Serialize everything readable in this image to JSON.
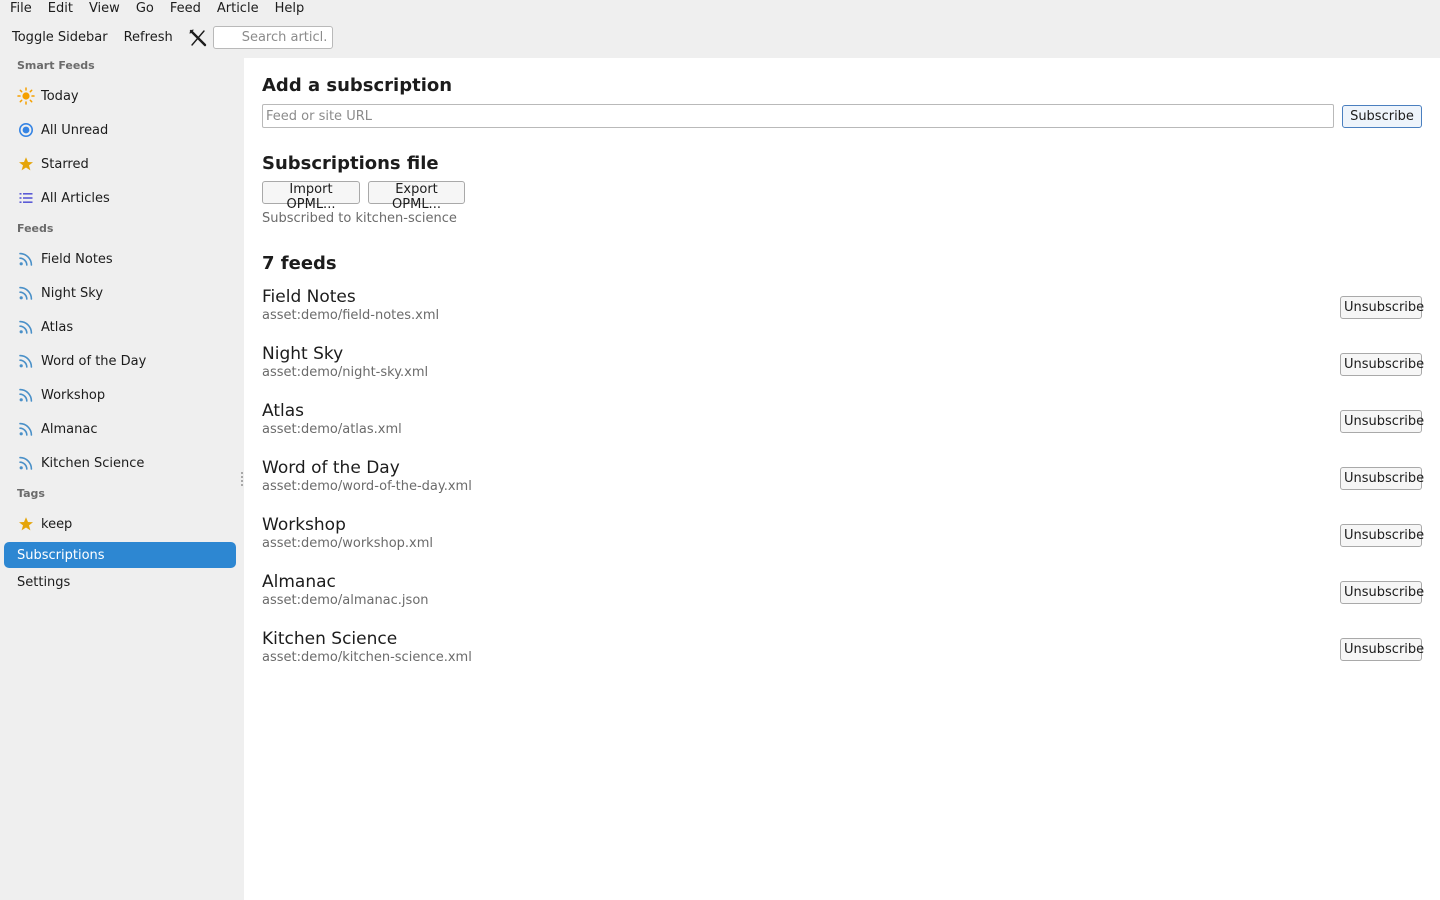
{
  "menu": [
    "File",
    "Edit",
    "View",
    "Go",
    "Feed",
    "Article",
    "Help"
  ],
  "toolbar": {
    "toggle_sidebar": "Toggle Sidebar",
    "refresh": "Refresh",
    "clear_icon": "close-x-icon",
    "search_placeholder": "Search articl..."
  },
  "sidebar": {
    "smart_feeds_label": "Smart Feeds",
    "smart_feeds": [
      {
        "label": "Today",
        "icon": "sun-icon"
      },
      {
        "label": "All Unread",
        "icon": "radio-circle-icon"
      },
      {
        "label": "Starred",
        "icon": "star-icon"
      },
      {
        "label": "All Articles",
        "icon": "list-icon"
      }
    ],
    "feeds_label": "Feeds",
    "feeds": [
      {
        "label": "Field Notes",
        "icon": "rss-icon"
      },
      {
        "label": "Night Sky",
        "icon": "rss-icon"
      },
      {
        "label": "Atlas",
        "icon": "rss-icon"
      },
      {
        "label": "Word of the Day",
        "icon": "rss-icon"
      },
      {
        "label": "Workshop",
        "icon": "rss-icon"
      },
      {
        "label": "Almanac",
        "icon": "rss-icon"
      },
      {
        "label": "Kitchen Science",
        "icon": "rss-icon"
      }
    ],
    "tags_label": "Tags",
    "tags": [
      {
        "label": "keep",
        "icon": "star-icon"
      }
    ],
    "subscriptions": "Subscriptions",
    "settings": "Settings"
  },
  "main": {
    "add_heading": "Add a subscription",
    "url_placeholder": "Feed or site URL",
    "subscribe_button": "Subscribe",
    "file_heading": "Subscriptions file",
    "import_button": "Import OPML...",
    "export_button": "Export OPML...",
    "status": "Subscribed to kitchen-science",
    "feeds_heading": "7 feeds",
    "unsubscribe_label": "Unsubscribe",
    "feed_list": [
      {
        "name": "Field Notes",
        "url": "asset:demo/field-notes.xml"
      },
      {
        "name": "Night Sky",
        "url": "asset:demo/night-sky.xml"
      },
      {
        "name": "Atlas",
        "url": "asset:demo/atlas.xml"
      },
      {
        "name": "Word of the Day",
        "url": "asset:demo/word-of-the-day.xml"
      },
      {
        "name": "Workshop",
        "url": "asset:demo/workshop.xml"
      },
      {
        "name": "Almanac",
        "url": "asset:demo/almanac.json"
      },
      {
        "name": "Kitchen Science",
        "url": "asset:demo/kitchen-science.xml"
      }
    ]
  },
  "colors": {
    "accent": "#2d87d2",
    "sun": "#f5a000",
    "star": "#e5a50a",
    "unread": "#3584e4",
    "list": "#5b5bd6",
    "rss": "#4a90c8"
  }
}
